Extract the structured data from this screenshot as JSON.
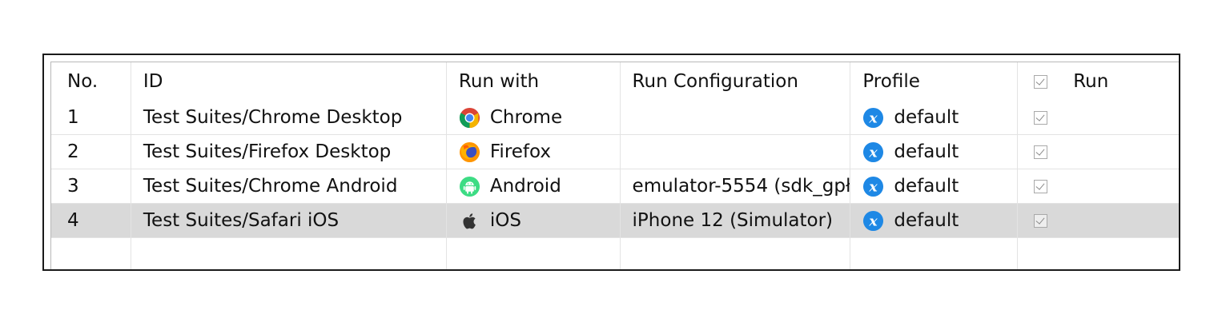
{
  "table": {
    "columns": {
      "no": "No.",
      "id": "ID",
      "run_with": "Run with",
      "run_configuration": "Run Configuration",
      "profile": "Profile",
      "run": "Run"
    },
    "header_run_checked": true,
    "rows": [
      {
        "no": "1",
        "id": "Test Suites/Chrome Desktop",
        "run_with": "Chrome",
        "run_with_icon": "chrome-icon",
        "run_configuration": "",
        "profile": "default",
        "profile_icon": "profile-x-icon",
        "run_checked": true,
        "selected": false
      },
      {
        "no": "2",
        "id": "Test Suites/Firefox Desktop",
        "run_with": "Firefox",
        "run_with_icon": "firefox-icon",
        "run_configuration": "",
        "profile": "default",
        "profile_icon": "profile-x-icon",
        "run_checked": true,
        "selected": false
      },
      {
        "no": "3",
        "id": "Test Suites/Chrome Android",
        "run_with": "Android",
        "run_with_icon": "android-icon",
        "run_configuration": "emulator-5554 (sdk_gpł",
        "profile": "default",
        "profile_icon": "profile-x-icon",
        "run_checked": true,
        "selected": false
      },
      {
        "no": "4",
        "id": "Test Suites/Safari iOS",
        "run_with": "iOS",
        "run_with_icon": "apple-icon",
        "run_configuration": "iPhone 12 (Simulator)",
        "profile": "default",
        "profile_icon": "profile-x-icon",
        "run_checked": true,
        "selected": true
      }
    ]
  },
  "colors": {
    "selected_row": "#d9d9d9",
    "profile_icon": "#1e88e5",
    "android_green": "#3ddc84"
  }
}
